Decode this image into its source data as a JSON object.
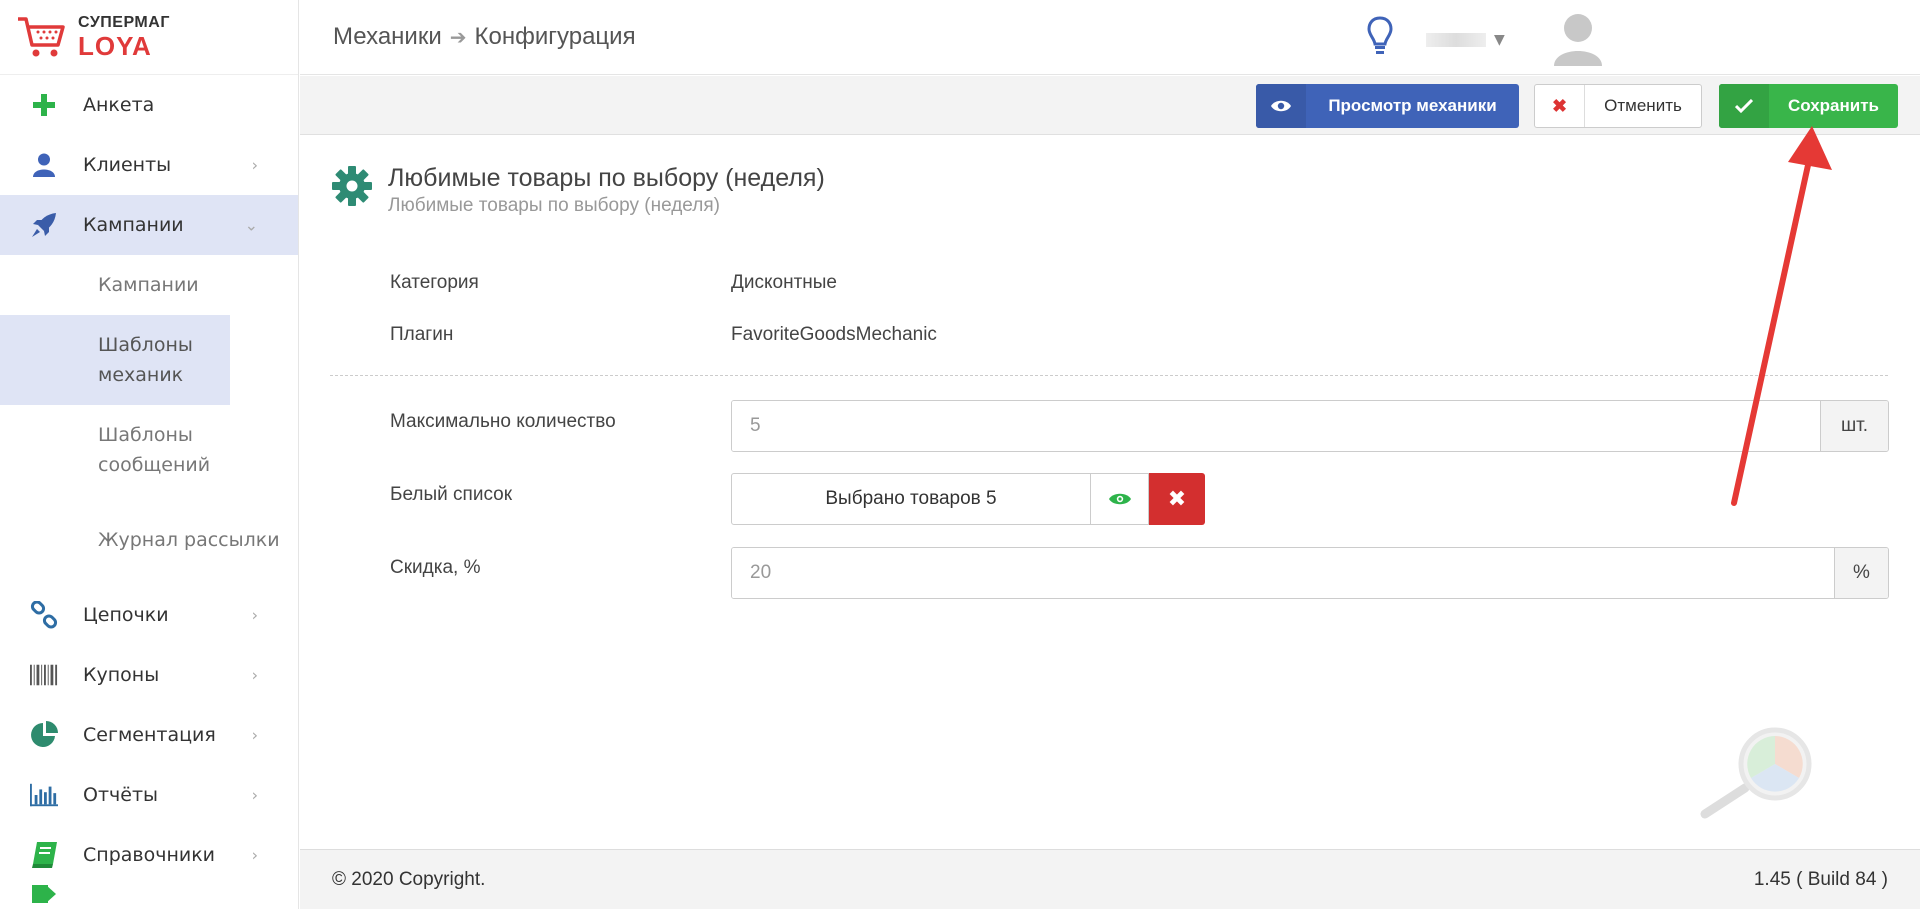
{
  "logo": {
    "top": "СУПЕРМАГ",
    "bottom": "LOYA"
  },
  "sidebar": {
    "items": [
      {
        "label": "Анкета"
      },
      {
        "label": "Клиенты",
        "chevron": "›"
      },
      {
        "label": "Кампании",
        "chevron": "⌄"
      },
      {
        "label": "Цепочки",
        "chevron": "›"
      },
      {
        "label": "Купоны",
        "chevron": "›"
      },
      {
        "label": "Сегментация",
        "chevron": "›"
      },
      {
        "label": "Отчёты",
        "chevron": "›"
      },
      {
        "label": "Справочники",
        "chevron": "›"
      }
    ],
    "sub": [
      {
        "label": "Кампании"
      },
      {
        "label": "Шаблоны механик"
      },
      {
        "label": "Шаблоны сообщений"
      },
      {
        "label": "Журнал рассылки"
      }
    ]
  },
  "header": {
    "crumbs": [
      "Механики",
      "Конфигурация"
    ]
  },
  "toolbar": {
    "view_label": "Просмотр механики",
    "cancel_label": "Отменить",
    "save_label": "Сохранить"
  },
  "content": {
    "title": "Любимые товары по выбору (неделя)",
    "subtitle": "Любимые товары по выбору (неделя)",
    "info": [
      {
        "label": "Категория",
        "value": "Дисконтные"
      },
      {
        "label": "Плагин",
        "value": "FavoriteGoodsMechanic"
      }
    ],
    "fields": {
      "max_label": "Максимально количество",
      "max_value": "5",
      "max_unit": "шт.",
      "whitelist_label": "Белый список",
      "whitelist_value": "Выбрано товаров 5",
      "discount_label": "Скидка, %",
      "discount_value": "20",
      "discount_unit": "%"
    }
  },
  "footer": {
    "copyright": "© 2020 Copyright.",
    "version": "1.45 ( Build 84 )"
  },
  "colors": {
    "accent_blue": "#3f63b8",
    "success_green": "#39b54a",
    "danger_red": "#d32f2f",
    "gear_teal": "#2e8b74"
  }
}
